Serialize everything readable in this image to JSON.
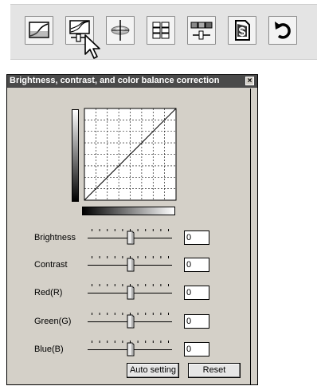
{
  "toolbar": {
    "buttons": [
      {
        "icon": "tone-curve-icon"
      },
      {
        "icon": "brightness-contrast-icon"
      },
      {
        "icon": "hue-saturation-icon"
      },
      {
        "icon": "variations-icon"
      },
      {
        "icon": "color-balance-slider-icon"
      },
      {
        "icon": "save-settings-icon"
      },
      {
        "icon": "undo-icon"
      }
    ]
  },
  "dialog": {
    "title": "Brightness, contrast, and color balance correction",
    "close_label": "×",
    "sliders": [
      {
        "label": "Brightness",
        "value": "0"
      },
      {
        "label": "Contrast",
        "value": "0"
      },
      {
        "label": "Red(R)",
        "value": "0"
      },
      {
        "label": "Green(G)",
        "value": "0"
      },
      {
        "label": "Blue(B)",
        "value": "0"
      }
    ],
    "auto_setting_label": "Auto setting",
    "reset_label": "Reset"
  }
}
